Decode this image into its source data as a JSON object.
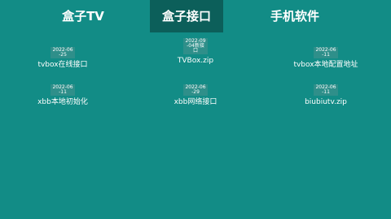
{
  "tabs": [
    "盒子TV",
    "盒子接口",
    "手机软件"
  ],
  "items": [
    {
      "date": "2022-06-25",
      "label": "tvbox在线接口"
    },
    {
      "date": "2022-09-04新接口",
      "label": "TVBox.zip"
    },
    {
      "date": "2022-06-11",
      "label": "tvbox本地配置地址"
    },
    {
      "date": "2022-06-11",
      "label": "xbb本地初始化"
    },
    {
      "date": "2022-06-29",
      "label": "xbb网络接口"
    },
    {
      "date": "2022-06-11",
      "label": "biubiutv.zip"
    }
  ]
}
